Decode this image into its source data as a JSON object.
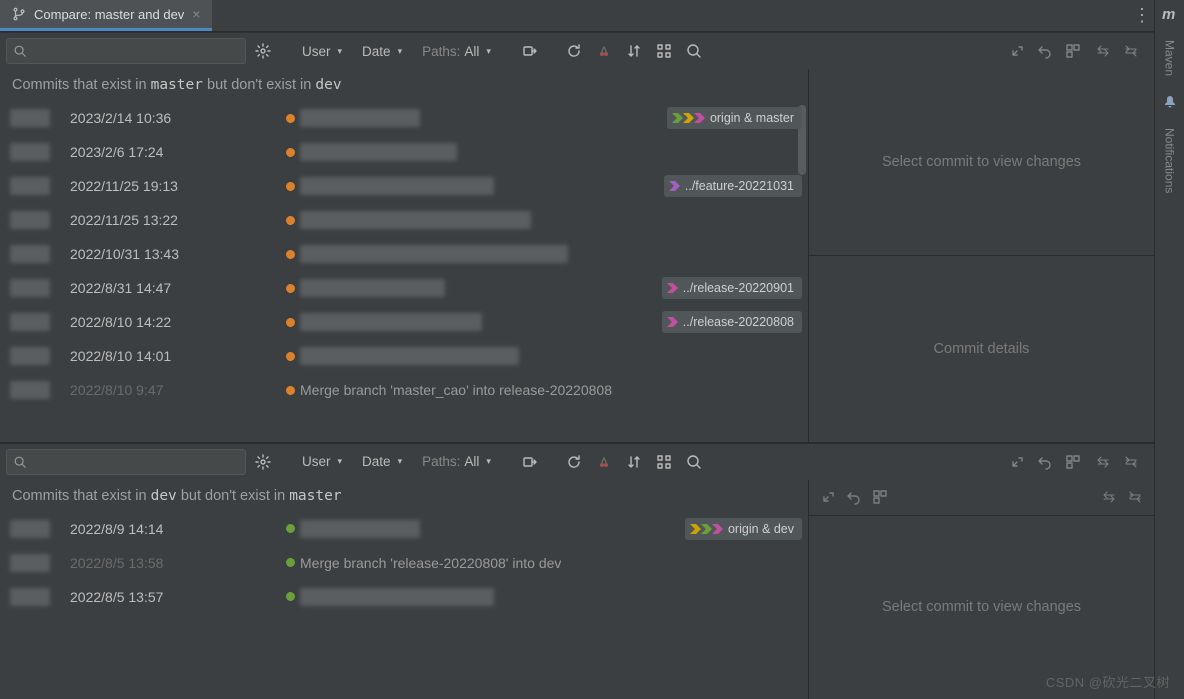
{
  "tab": {
    "title": "Compare: master and dev"
  },
  "toolbar": {
    "user": "User",
    "date": "Date",
    "paths_prefix": "Paths:",
    "paths_value": "All"
  },
  "top": {
    "caption_pre": "Commits that exist in ",
    "caption_b1": "master",
    "caption_mid": " but don't exist in ",
    "caption_b2": "dev",
    "commits": [
      {
        "date": "2023/2/14 10:36",
        "ref": "origin & master",
        "ref_colors": [
          "#6a9f3c",
          "#d0a400",
          "#c14f9e"
        ]
      },
      {
        "date": "2023/2/6 17:24"
      },
      {
        "date": "2022/11/25 19:13",
        "ref": "../feature-20221031",
        "ref_colors": [
          "#a35fc0"
        ]
      },
      {
        "date": "2022/11/25 13:22"
      },
      {
        "date": "2022/10/31 13:43"
      },
      {
        "date": "2022/8/31 14:47",
        "ref": "../release-20220901",
        "ref_colors": [
          "#c14f9e"
        ]
      },
      {
        "date": "2022/8/10 14:22",
        "ref": "../release-20220808",
        "ref_colors": [
          "#c14f9e"
        ]
      },
      {
        "date": "2022/8/10 14:01"
      },
      {
        "date": "2022/8/10 9:47",
        "msg": "Merge branch 'master_cao' into release-20220808",
        "dim": true
      }
    ],
    "details_select": "Select commit to view changes",
    "details_commit": "Commit details"
  },
  "bot": {
    "caption_pre": "Commits that exist in ",
    "caption_b1": "dev",
    "caption_mid": " but don't exist in ",
    "caption_b2": "master",
    "commits": [
      {
        "date": "2022/8/9 14:14",
        "ref": "origin & dev",
        "ref_colors": [
          "#d0a400",
          "#6a9f3c",
          "#c14f9e"
        ]
      },
      {
        "date": "2022/8/5 13:58",
        "msg": "Merge branch 'release-20220808' into dev",
        "dim": true
      },
      {
        "date": "2022/8/5 13:57"
      }
    ],
    "details_select": "Select commit to view changes"
  },
  "right": {
    "maven": "Maven",
    "notifications": "Notifications"
  },
  "watermark": "CSDN @砍光二叉树"
}
